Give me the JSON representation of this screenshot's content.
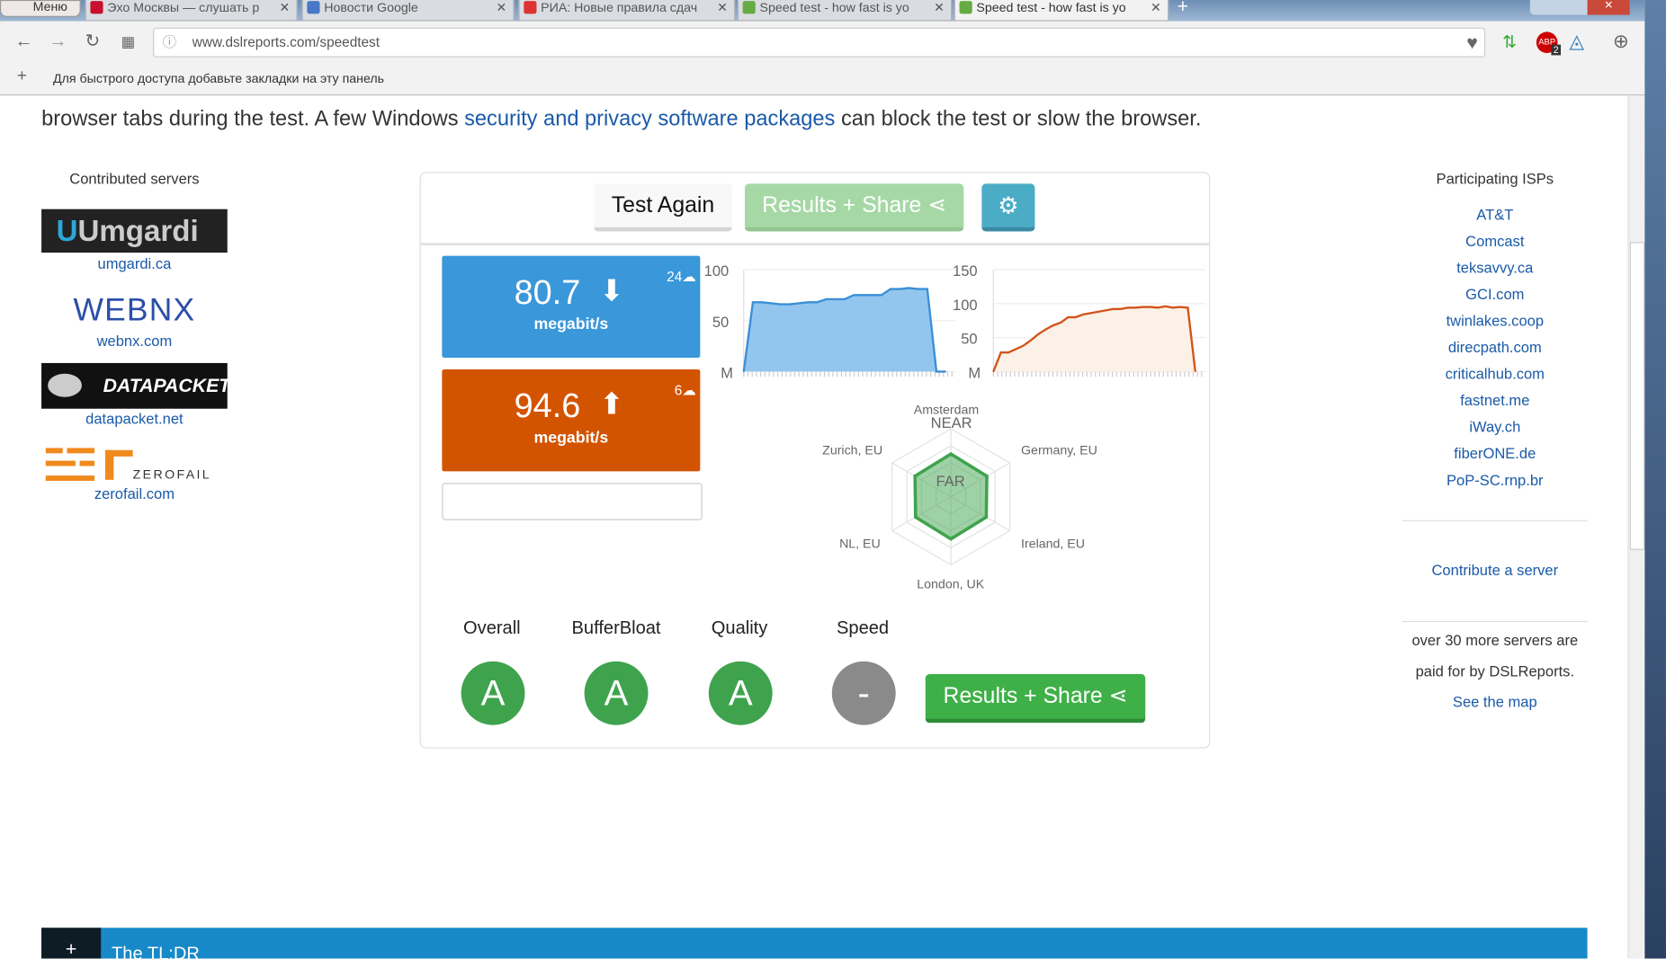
{
  "browser": {
    "menu_label": "Меню",
    "tabs": [
      {
        "title": "Эхо Москвы — слушать р",
        "color": "#c8102e"
      },
      {
        "title": "Новости Google",
        "color": "#4a78c8"
      },
      {
        "title": "РИА: Новые правила сдач",
        "color": "#d33"
      },
      {
        "title": "Speed test - how fast is yo",
        "color": "#6a4"
      },
      {
        "title": "Speed test - how fast is yo",
        "color": "#6a4",
        "active": true
      }
    ],
    "url": "www.dslreports.com/speedtest",
    "bookmarks_hint": "Для быстрого доступа добавьте закладки на эту панель",
    "abp_badge": "2"
  },
  "intro": {
    "before": "browser tabs during the test. A few Windows ",
    "link": "security and privacy software packages",
    "after": " can block the test or slow the browser."
  },
  "left": {
    "title": "Contributed servers",
    "servers": [
      {
        "name": "Umgardi",
        "link": "umgardi.ca"
      },
      {
        "name": "WEBNX",
        "link": "webnx.com"
      },
      {
        "name": "DATAPACKET",
        "link": "datapacket.net"
      },
      {
        "name": "ZEROFAIL",
        "link": "zerofail.com"
      }
    ]
  },
  "panel": {
    "test_again": "Test Again",
    "results_share": "Results + Share",
    "download": {
      "value": "80.7",
      "unit": "megabit/s",
      "streams": "24"
    },
    "upload": {
      "value": "94.6",
      "unit": "megabit/s",
      "streams": "6"
    },
    "grades": [
      {
        "label": "Overall",
        "grade": "A"
      },
      {
        "label": "BufferBloat",
        "grade": "A"
      },
      {
        "label": "Quality",
        "grade": "A"
      },
      {
        "label": "Speed",
        "grade": "-"
      }
    ],
    "results_share_bottom": "Results + Share",
    "radar": {
      "top_note": "NEAR",
      "center_note": "FAR"
    }
  },
  "chart_data": [
    {
      "type": "area",
      "title": "download",
      "y_ticks": [
        "100",
        "50",
        "M"
      ],
      "ylim": [
        0,
        100
      ],
      "color": "#3a8fd8",
      "values": [
        0,
        68,
        68,
        67,
        66,
        66,
        67,
        68,
        68,
        71,
        71,
        71,
        75,
        75,
        75,
        75,
        81,
        81,
        82,
        81,
        81,
        0,
        0
      ]
    },
    {
      "type": "area",
      "title": "upload",
      "y_ticks": [
        "150",
        "100",
        "50",
        "M"
      ],
      "ylim": [
        0,
        150
      ],
      "color": "#d2541a",
      "values": [
        0,
        28,
        28,
        33,
        38,
        46,
        55,
        62,
        68,
        72,
        80,
        80,
        84,
        86,
        88,
        90,
        92,
        92,
        94,
        94,
        95,
        95,
        94,
        96,
        94,
        95,
        94,
        0
      ]
    },
    {
      "type": "radar",
      "labels": [
        "Amsterdam",
        "Germany, EU",
        "Ireland, EU",
        "London, UK",
        "NL, EU",
        "Zurich, EU"
      ],
      "values": [
        0.63,
        0.61,
        0.6,
        0.62,
        0.6,
        0.61
      ],
      "color": "#3fa34d"
    }
  ],
  "right": {
    "title": "Participating ISPs",
    "isps": [
      "AT&T",
      "Comcast",
      "teksavvy.ca",
      "GCI.com",
      "twinlakes.coop",
      "direcpath.com",
      "criticalhub.com",
      "fastnet.me",
      "iWay.ch",
      "fiberONE.de",
      "PoP-SC.rnp.br"
    ],
    "contribute": "Contribute a server",
    "note1": "over 30 more servers are",
    "note2": "paid for by DSLReports.",
    "map_link": "See the map"
  },
  "footer": {
    "plus": "+",
    "title": "The TL;DR"
  }
}
